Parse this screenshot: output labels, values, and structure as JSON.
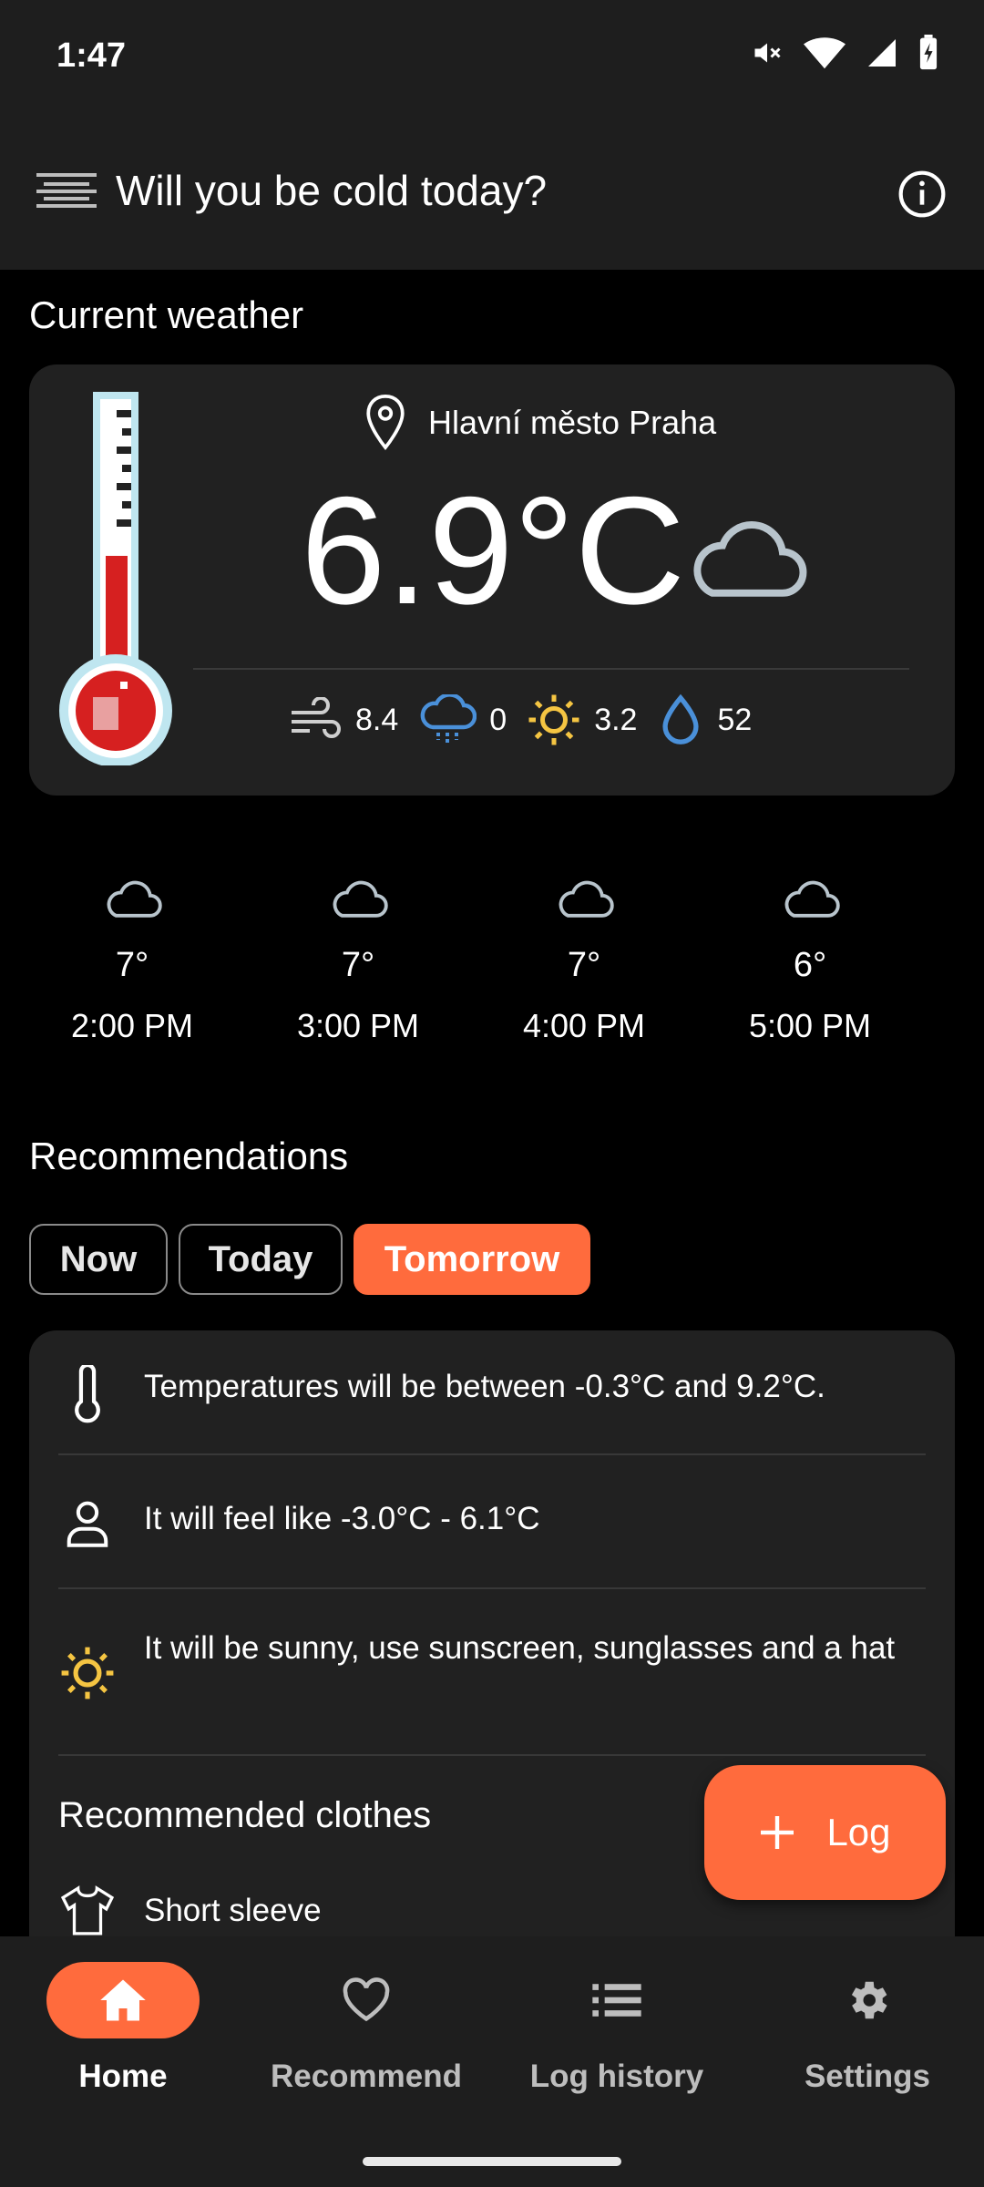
{
  "status_bar": {
    "time": "1:47",
    "icons": [
      "mute-icon",
      "wifi-icon",
      "signal-icon",
      "battery-charging-icon"
    ]
  },
  "app_bar": {
    "title": "Will you be cold today?"
  },
  "current": {
    "section_title": "Current weather",
    "location": "Hlavní město Praha",
    "temperature": "6.9°C",
    "condition_icon": "cloud-icon",
    "metrics": [
      {
        "icon": "wind-icon",
        "value": "8.4"
      },
      {
        "icon": "rain-cloud-icon",
        "value": "0"
      },
      {
        "icon": "sun-icon",
        "value": "3.2"
      },
      {
        "icon": "droplet-icon",
        "value": "52"
      }
    ]
  },
  "forecast": [
    {
      "icon": "cloud-icon",
      "temp": "7°",
      "time": "2:00 PM"
    },
    {
      "icon": "cloud-icon",
      "temp": "7°",
      "time": "3:00 PM"
    },
    {
      "icon": "cloud-icon",
      "temp": "7°",
      "time": "4:00 PM"
    },
    {
      "icon": "cloud-icon",
      "temp": "6°",
      "time": "5:00 PM"
    }
  ],
  "recommendations": {
    "section_title": "Recommendations",
    "tabs": [
      {
        "label": "Now",
        "active": false
      },
      {
        "label": "Today",
        "active": false
      },
      {
        "label": "Tomorrow",
        "active": true
      }
    ],
    "items": [
      {
        "icon": "thermometer-icon",
        "text": "Temperatures will be between -0.3°C and 9.2°C."
      },
      {
        "icon": "person-icon",
        "text": "It will feel like -3.0°C - 6.1°C"
      },
      {
        "icon": "sun-icon",
        "text": "It will be sunny, use sunscreen, sunglasses and a hat"
      }
    ],
    "clothes_title": "Recommended clothes",
    "clothes": [
      {
        "icon": "shirt-icon",
        "label": "Short sleeve"
      }
    ]
  },
  "fab": {
    "label": "Log"
  },
  "nav": [
    {
      "label": "Home",
      "icon": "home-icon",
      "active": true
    },
    {
      "label": "Recommend",
      "icon": "heart-icon",
      "active": false
    },
    {
      "label": "Log history",
      "icon": "list-icon",
      "active": false
    },
    {
      "label": "Settings",
      "icon": "gear-icon",
      "active": false
    }
  ],
  "colors": {
    "accent": "#ff6b3d",
    "surface": "#212121",
    "background": "#000000",
    "bar": "#1e1e1e",
    "rain_blue": "#4a90d9",
    "sun_yellow": "#f5c542"
  }
}
